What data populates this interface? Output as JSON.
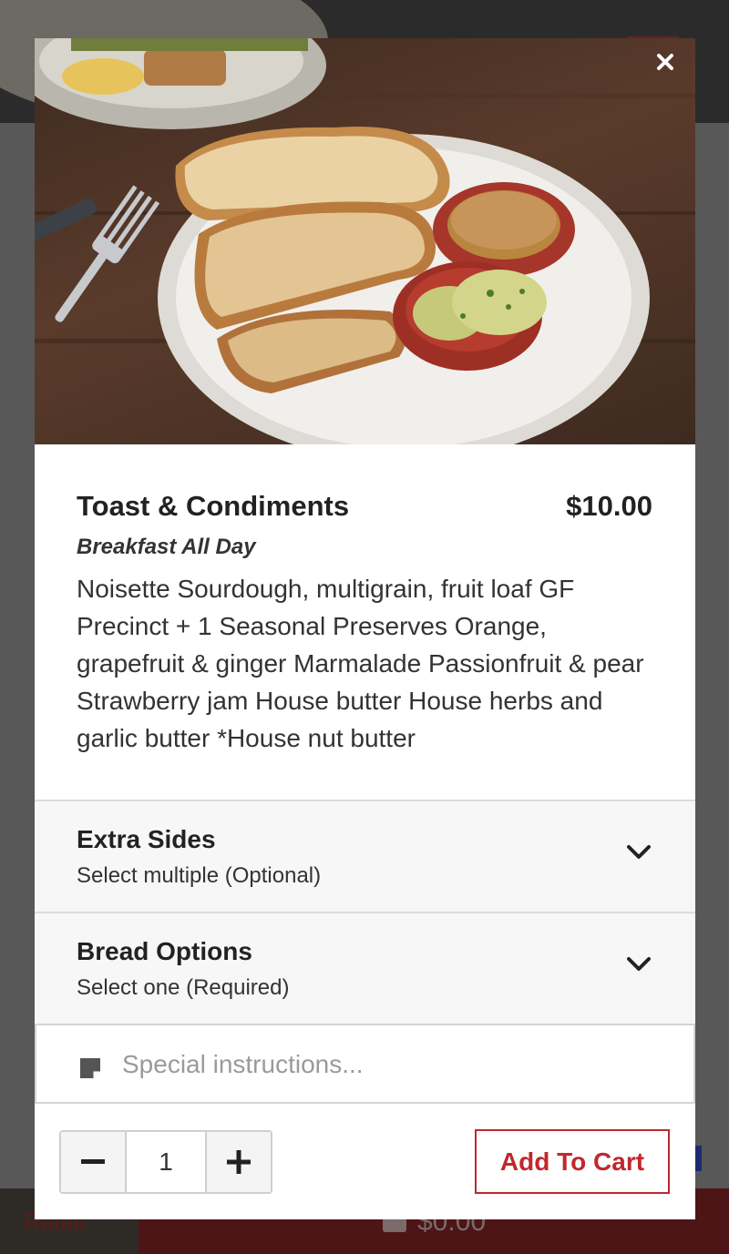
{
  "background": {
    "bottom_bar": {
      "left_label": "Retail",
      "cart_total": "$0.00"
    }
  },
  "modal": {
    "image_alt": "Toast & Condiments",
    "item": {
      "title": "Toast & Condiments",
      "price": "$10.00",
      "category": "Breakfast All Day",
      "description": "Noisette Sourdough, multigrain, fruit loaf GF Precinct + 1 Seasonal Preserves Orange, grapefruit & ginger Marmalade Passionfruit & pear Strawberry jam House butter House herbs and garlic butter *House nut butter"
    },
    "options": [
      {
        "title": "Extra Sides",
        "subtitle": "Select multiple (Optional)"
      },
      {
        "title": "Bread Options",
        "subtitle": "Select one (Required)"
      }
    ],
    "instructions": {
      "placeholder": "Special instructions...",
      "value": ""
    },
    "quantity": {
      "value": "1"
    },
    "add_to_cart_label": "Add To Cart"
  },
  "colors": {
    "accent": "#c0282d",
    "overlay": "#585858"
  },
  "icons": {
    "close": "close-icon",
    "chevron": "chevron-down-icon",
    "note": "note-icon",
    "minus": "minus-icon",
    "plus": "plus-icon",
    "cart": "cart-icon"
  }
}
